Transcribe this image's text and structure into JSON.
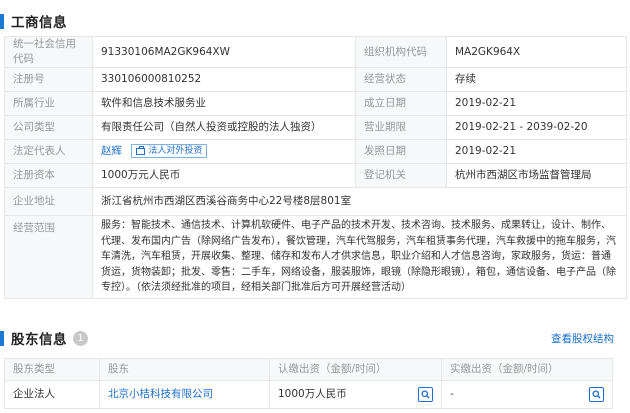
{
  "business_info": {
    "title": "工商信息",
    "rows": [
      {
        "l1": "统一社会信用代码",
        "v1": "91330106MA2GK964XW",
        "l2": "组织机构代码",
        "v2": "MA2GK964X"
      },
      {
        "l1": "注册号",
        "v1": "330106000810252",
        "l2": "经营状态",
        "v2": "存续"
      },
      {
        "l1": "所属行业",
        "v1": "软件和信息技术服务业",
        "l2": "成立日期",
        "v2": "2019-02-21"
      },
      {
        "l1": "公司类型",
        "v1": "有限责任公司（自然人投资或控股的法人独资）",
        "l2": "营业期限",
        "v2": "2019-02-21 - 2039-02-20"
      },
      {
        "l1": "法定代表人",
        "v1": "赵辉",
        "l2": "发照日期",
        "v2": "2019-02-21"
      },
      {
        "l1": "注册资本",
        "v1": "1000万元人民币",
        "l2": "登记机关",
        "v2": "杭州市西湖区市场监督管理局"
      }
    ],
    "legal_rep_tag": "法人对外投资",
    "address_label": "企业地址",
    "address": "浙江省杭州市西湖区西溪谷商务中心22号楼8层801室",
    "scope_label": "经营范围",
    "scope": "服务：智能技术、通信技术、计算机软硬件、电子产品的技术开发、技术咨询、技术服务、成果转让，设计、制作、代理、发布国内广告（除网络广告发布），餐饮管理，汽车代驾服务，汽车租赁事务代理，汽车救援中的拖车服务，汽车清洗，汽车租赁，开展收集、整理、储存和发布人才供求信息，职业介绍和人才信息咨询，家政服务，货运：普通货运，货物装卸；批发、零售：二手车，网络设备，服装服饰，眼镜（除隐形眼镜），箱包，通信设备、电子产品（除专控）。（依法须经批准的项目，经相关部门批准后方可开展经营活动）"
  },
  "shareholders": {
    "title": "股东信息",
    "count": "1",
    "link": "查看股权结构",
    "headers": [
      "股东类型",
      "股东",
      "认缴出资（金额/时间）",
      "实缴出资（金额/时间）"
    ],
    "rows": [
      {
        "type": "企业法人",
        "name": "北京小桔科技有限公司",
        "subscribed": "1000万人民币",
        "paid": "-"
      }
    ]
  }
}
